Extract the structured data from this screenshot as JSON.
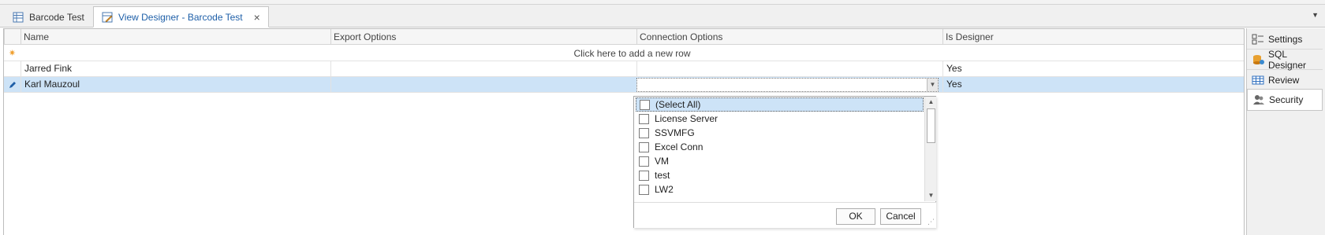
{
  "tabs": [
    {
      "label": "Barcode Test",
      "icon": "grid-table-icon",
      "active": false
    },
    {
      "label": "View Designer - Barcode Test",
      "icon": "view-designer-icon",
      "active": true
    }
  ],
  "grid": {
    "columns": [
      "Name",
      "Export Options",
      "Connection Options",
      "Is Designer"
    ],
    "new_row_text": "Click here to add a new row",
    "rows": [
      {
        "name": "Jarred Fink",
        "export": "",
        "connection": "",
        "designer": "Yes"
      },
      {
        "name": "Karl Mauzoul",
        "export": "",
        "connection": "",
        "designer": "Yes"
      }
    ]
  },
  "popup": {
    "items": [
      "(Select All)",
      "License Server",
      "SSVMFG",
      "Excel Conn",
      "VM",
      "test",
      "LW2"
    ],
    "ok_label": "OK",
    "cancel_label": "Cancel"
  },
  "side_panel": [
    {
      "label": "Settings",
      "icon": "settings-icon"
    },
    {
      "label": "SQL Designer",
      "icon": "database-icon"
    },
    {
      "label": "Review",
      "icon": "table-icon"
    },
    {
      "label": "Security",
      "icon": "users-icon",
      "active": true
    }
  ],
  "colors": {
    "accent": "#1e5fa8",
    "selection": "#cde3f7",
    "star": "#f0a030"
  }
}
